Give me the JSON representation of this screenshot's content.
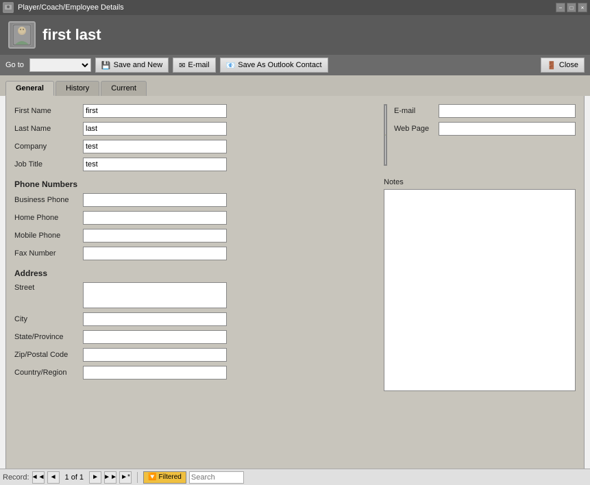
{
  "window": {
    "title": "Player/Coach/Employee Details",
    "minimize_label": "−",
    "restore_label": "□",
    "close_label": "×"
  },
  "header": {
    "title": "first last",
    "icon_symbol": "👤"
  },
  "toolbar": {
    "goto_label": "Go to",
    "goto_placeholder": "",
    "save_new_label": "Save and New",
    "email_label": "E-mail",
    "save_outlook_label": "Save As Outlook Contact",
    "close_label": "Close",
    "goto_icon": "📋",
    "save_new_icon": "💾",
    "email_icon": "✉",
    "save_outlook_icon": "📧",
    "close_icon": "🚪"
  },
  "tabs": [
    {
      "label": "General",
      "active": true
    },
    {
      "label": "History",
      "active": false
    },
    {
      "label": "Current",
      "active": false
    }
  ],
  "form": {
    "first_name_label": "First Name",
    "first_name_value": "first",
    "last_name_label": "Last Name",
    "last_name_value": "last",
    "company_label": "Company",
    "company_value": "test",
    "job_title_label": "Job Title",
    "job_title_value": "test",
    "phone_numbers_header": "Phone Numbers",
    "business_phone_label": "Business Phone",
    "business_phone_value": "",
    "home_phone_label": "Home Phone",
    "home_phone_value": "",
    "mobile_phone_label": "Mobile Phone",
    "mobile_phone_value": "",
    "fax_number_label": "Fax Number",
    "fax_number_value": "",
    "address_header": "Address",
    "street_label": "Street",
    "street_value": "",
    "city_label": "City",
    "city_value": "",
    "state_label": "State/Province",
    "state_value": "",
    "zip_label": "Zip/Postal Code",
    "zip_value": "",
    "country_label": "Country/Region",
    "country_value": "",
    "email_label": "E-mail",
    "email_value": "",
    "web_page_label": "Web Page",
    "web_page_value": "",
    "notes_label": "Notes",
    "notes_value": ""
  },
  "status_bar": {
    "record_label": "Record:",
    "first_label": "◄◄",
    "prev_label": "◄",
    "record_count": "1 of 1",
    "next_label": "►",
    "last_label": "►►",
    "new_label": "►*",
    "filtered_label": "Filtered",
    "search_label": "Search",
    "search_placeholder": "Search"
  }
}
